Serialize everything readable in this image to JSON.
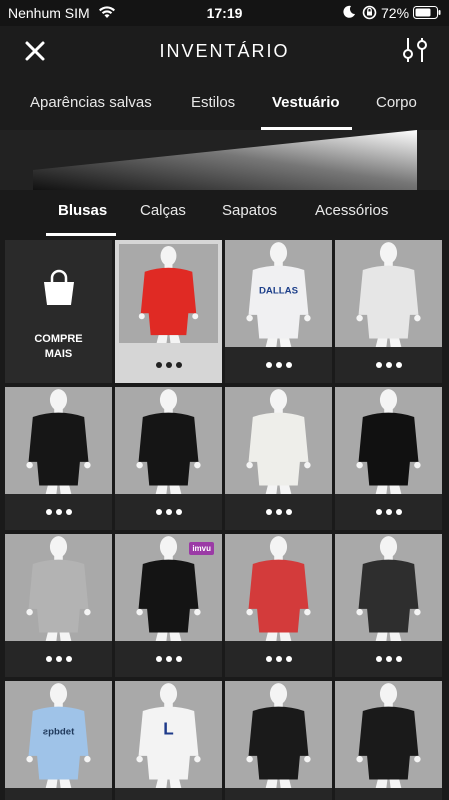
{
  "status": {
    "carrier": "Nenhum SIM",
    "time": "17:19",
    "battery": "72%"
  },
  "header": {
    "title": "INVENTÁRIO"
  },
  "top_tabs": [
    "Aparências salvas",
    "Estilos",
    "Vestuário",
    "Corpo"
  ],
  "sub_tabs": [
    "Blusas",
    "Calças",
    "Sapatos",
    "Acessórios"
  ],
  "shop": {
    "label_line1": "COMPRE",
    "label_line2": "MAIS"
  },
  "grid": {
    "items": [
      {
        "name": "red-bandana-jacket",
        "color": "#e02a24"
      },
      {
        "name": "dallas-jersey",
        "color": "#f0f0f2",
        "text": "DALLAS"
      },
      {
        "name": "tattoo-arm-shirt",
        "color": "#e6e6e6"
      },
      {
        "name": "black-blazer",
        "color": "#161616"
      },
      {
        "name": "black-red-graphic-shirt",
        "color": "#151515"
      },
      {
        "name": "white-button-shirt",
        "color": "#eeeeea"
      },
      {
        "name": "black-tank-top",
        "color": "#111111"
      },
      {
        "name": "gray-tank-top",
        "color": "#b3b3b3"
      },
      {
        "name": "black-track-jacket",
        "color": "#141414",
        "badge": "imvu"
      },
      {
        "name": "floral-shirt",
        "color": "#d33b3b"
      },
      {
        "name": "striped-shirt",
        "color": "#2e2e2e"
      },
      {
        "name": "blue-hoodie",
        "color": "#9fc3e8",
        "text": "ƨpbdet"
      },
      {
        "name": "white-l-tee",
        "color": "#f3f3f3",
        "text": "L"
      },
      {
        "name": "black-tee",
        "color": "#1a1a1a"
      },
      {
        "name": "black-graphic-tee",
        "color": "#1a1a1a"
      }
    ]
  }
}
